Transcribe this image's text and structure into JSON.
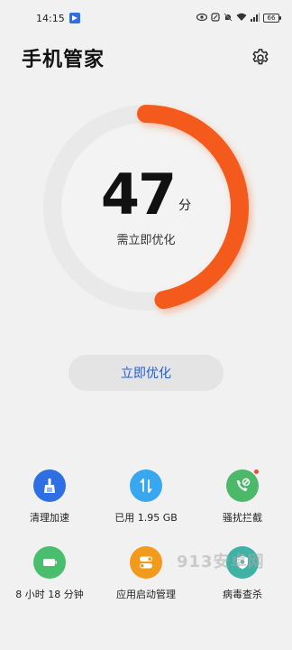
{
  "status_bar": {
    "time": "14:15",
    "battery": "66"
  },
  "header": {
    "title": "手机管家",
    "settings_icon": "gear-icon"
  },
  "score": {
    "value": "47",
    "unit": "分",
    "status": "需立即优化",
    "fraction": 0.47,
    "ring_color": "#f45a1e",
    "track_color": "#e9e9e9"
  },
  "optimize_button": {
    "label": "立即优化"
  },
  "tools": [
    {
      "label": "清理加速",
      "icon": "broom-icon",
      "color": "#2f6fe4"
    },
    {
      "label": "已用 1.95 GB",
      "icon": "data-usage-icon",
      "color": "#39a7f0"
    },
    {
      "label": "骚扰拦截",
      "icon": "phone-block-icon",
      "color": "#4cb86a"
    },
    {
      "label": "8 小时 18 分钟",
      "icon": "battery-icon",
      "color": "#49bf6d"
    },
    {
      "label": "应用启动管理",
      "icon": "toggle-icon",
      "color": "#f29a1c"
    },
    {
      "label": "病毒查杀",
      "icon": "shield-icon",
      "color": "#3fb2a6"
    }
  ],
  "watermark": "913安卓网"
}
